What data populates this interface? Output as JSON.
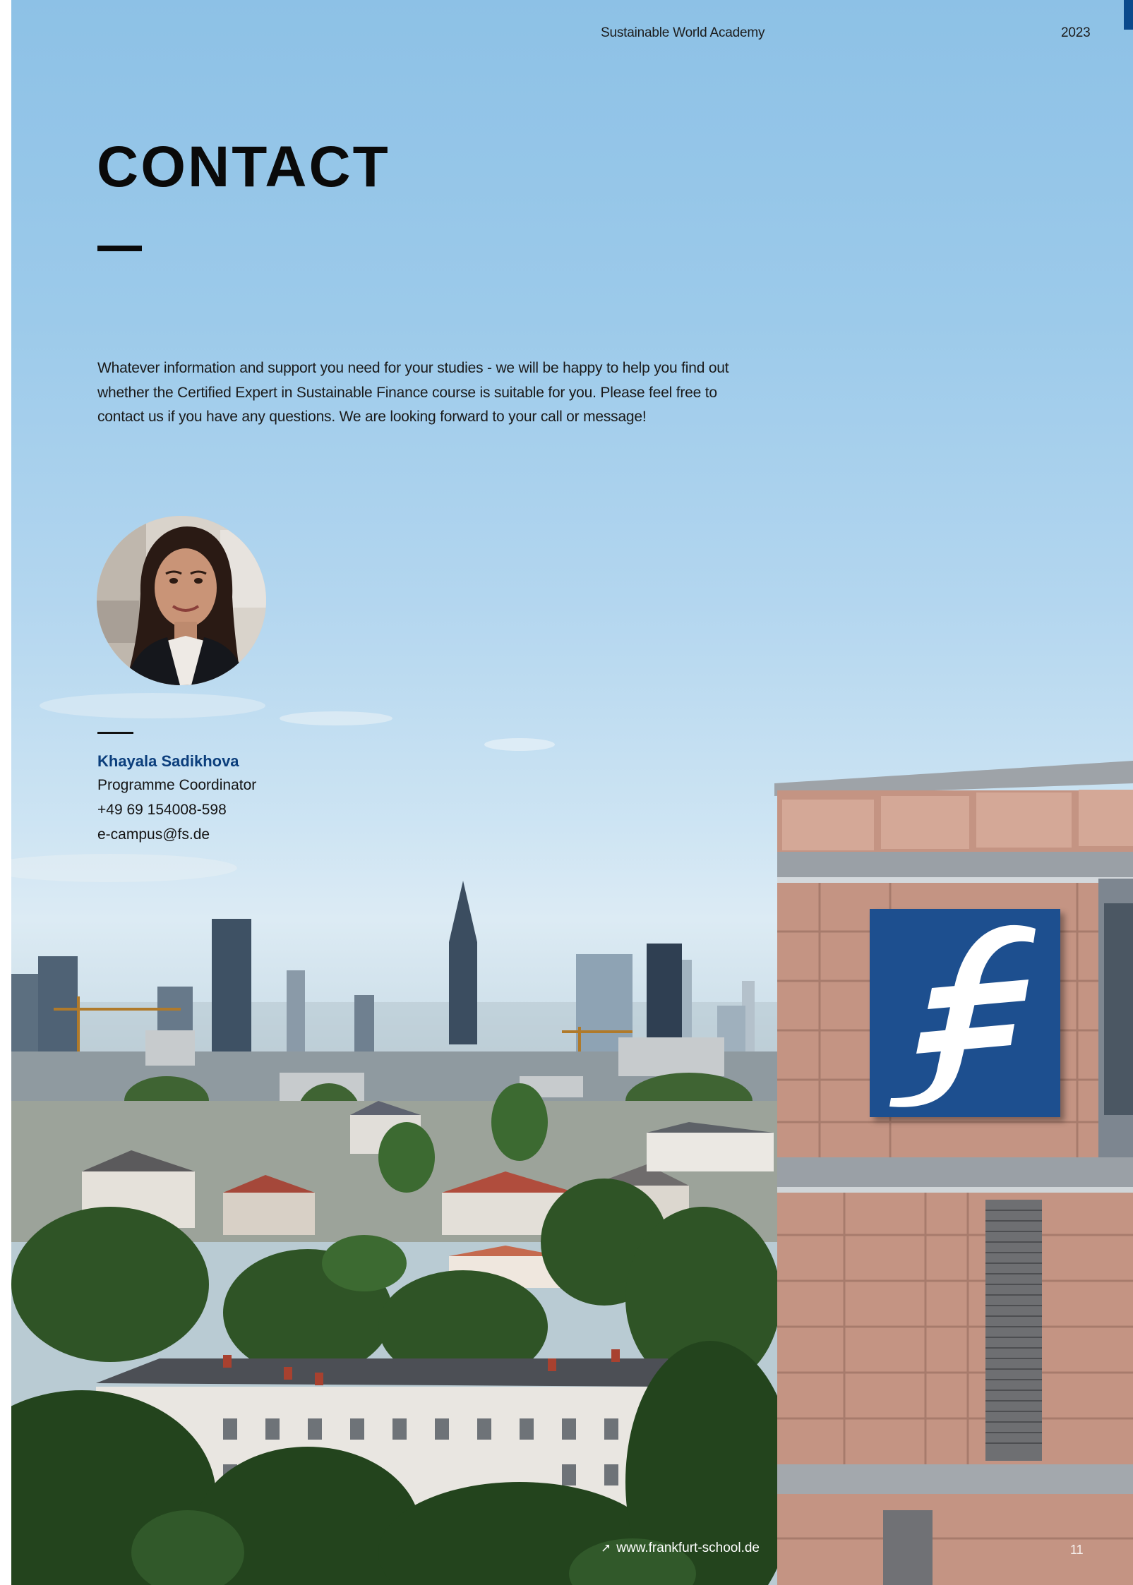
{
  "header": {
    "academy": "Sustainable World Academy",
    "year": "2023"
  },
  "title": "CONTACT",
  "intro": "Whatever information and support you need for your studies - we will be happy to help you find out whether the Certified Expert in Sustainable Finance course is suitable for you. Please feel free to contact us if you have any questions. We are looking forward to your call or message!",
  "contact": {
    "name": "Khayala Sadikhova",
    "role": "Programme Coordinator",
    "phone": "+49 69 154008-598",
    "email": "e-campus@fs.de"
  },
  "footer": {
    "link_icon": "arrow-up-right-icon",
    "link": "www.frankfurt-school.de",
    "page_number": "11"
  },
  "colors": {
    "accent": "#0b4a8c",
    "name": "#0b3e7c",
    "logo_blue": "#1d4f8f"
  }
}
